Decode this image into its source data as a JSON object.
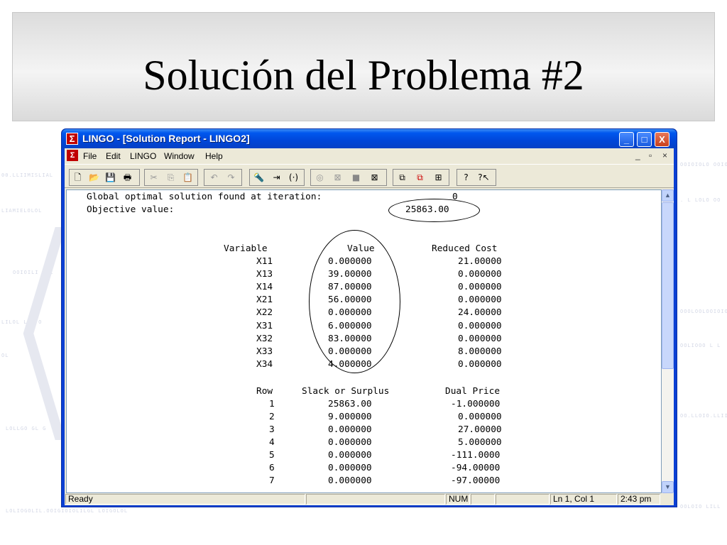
{
  "slide": {
    "title": "Solución del Problema #2"
  },
  "window": {
    "title": "LINGO - [Solution Report - LINGO2]",
    "controls": [
      "_",
      "□",
      "X"
    ]
  },
  "menubar": {
    "items": [
      "File",
      "Edit",
      "LINGO",
      "Window",
      "Help"
    ],
    "mdi_controls": [
      "_",
      "ð",
      "×"
    ]
  },
  "toolbar": {
    "icons": [
      "new-icon",
      "open-icon",
      "save-icon",
      "print-icon",
      "cut-icon",
      "copy-icon",
      "paste-icon",
      "undo-icon",
      "redo-icon",
      "find-icon",
      "goto-icon",
      "match-paren-icon",
      "solve-icon",
      "close-solve-icon",
      "stop-icon",
      "options-icon",
      "send-to-back-icon",
      "close-all-icon",
      "tile-icon",
      "help-icon",
      "context-help-icon"
    ]
  },
  "report": {
    "header_line1_label": "Global optimal solution found at iteration:",
    "header_line1_value": "0",
    "header_line2_label": "Objective value:",
    "header_line2_value": "25863.00",
    "variables_headers": [
      "Variable",
      "Value",
      "Reduced Cost"
    ],
    "variables": [
      {
        "name": "X11",
        "value": "0.000000",
        "reduced_cost": "21.00000"
      },
      {
        "name": "X13",
        "value": "39.00000",
        "reduced_cost": "0.000000"
      },
      {
        "name": "X14",
        "value": "87.00000",
        "reduced_cost": "0.000000"
      },
      {
        "name": "X21",
        "value": "56.00000",
        "reduced_cost": "0.000000"
      },
      {
        "name": "X22",
        "value": "0.000000",
        "reduced_cost": "24.00000"
      },
      {
        "name": "X31",
        "value": "6.000000",
        "reduced_cost": "0.000000"
      },
      {
        "name": "X32",
        "value": "83.00000",
        "reduced_cost": "0.000000"
      },
      {
        "name": "X33",
        "value": "0.000000",
        "reduced_cost": "8.000000"
      },
      {
        "name": "X34",
        "value": "4.000000",
        "reduced_cost": "0.000000"
      }
    ],
    "rows_headers": [
      "Row",
      "Slack or Surplus",
      "Dual Price"
    ],
    "rows": [
      {
        "row": "1",
        "slack": "25863.00",
        "dual": "-1.000000"
      },
      {
        "row": "2",
        "slack": "9.000000",
        "dual": "0.000000"
      },
      {
        "row": "3",
        "slack": "0.000000",
        "dual": "27.00000"
      },
      {
        "row": "4",
        "slack": "0.000000",
        "dual": "5.000000"
      },
      {
        "row": "5",
        "slack": "0.000000",
        "dual": "-111.0000"
      },
      {
        "row": "6",
        "slack": "0.000000",
        "dual": "-94.00000"
      },
      {
        "row": "7",
        "slack": "0.000000",
        "dual": "-97.00000"
      }
    ]
  },
  "statusbar": {
    "ready": "Ready",
    "num": "NUM",
    "position": "Ln 1, Col 1",
    "time": "2:43 pm"
  }
}
